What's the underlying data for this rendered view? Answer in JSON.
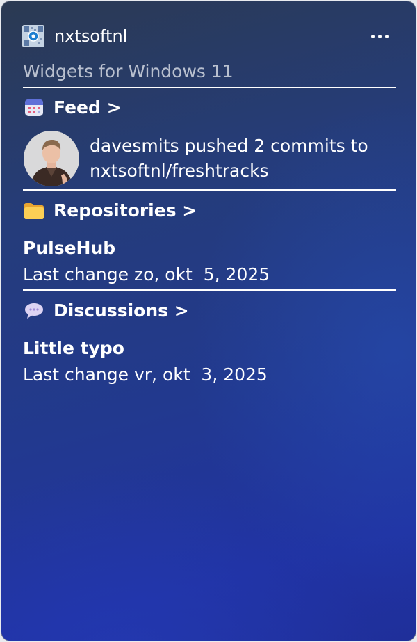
{
  "header": {
    "app_name": "nxtsoftnl",
    "app_icon": "app-logo-icon",
    "more_icon": "more-icon",
    "subtitle": "Widgets for Windows 11"
  },
  "feed": {
    "title": "Feed >",
    "icon": "calendar-icon",
    "entry": {
      "avatar": "avatar",
      "text": "davesmits pushed 2 commits to nxtsoftnl/freshtracks"
    }
  },
  "repositories": {
    "title": "Repositories >",
    "icon": "folder-icon",
    "item_title": "PulseHub",
    "item_subtitle": "Last change zo, okt  5, 2025"
  },
  "discussions": {
    "title": "Discussions >",
    "icon": "speech-bubble-icon",
    "item_title": "Little typo",
    "item_subtitle": "Last change vr, okt  3, 2025"
  },
  "colors": {
    "background_top": "#2b3a52",
    "background_bottom": "#1f2f9a",
    "subtitle_text": "#b9c0cf",
    "divider": "#ffffff"
  }
}
